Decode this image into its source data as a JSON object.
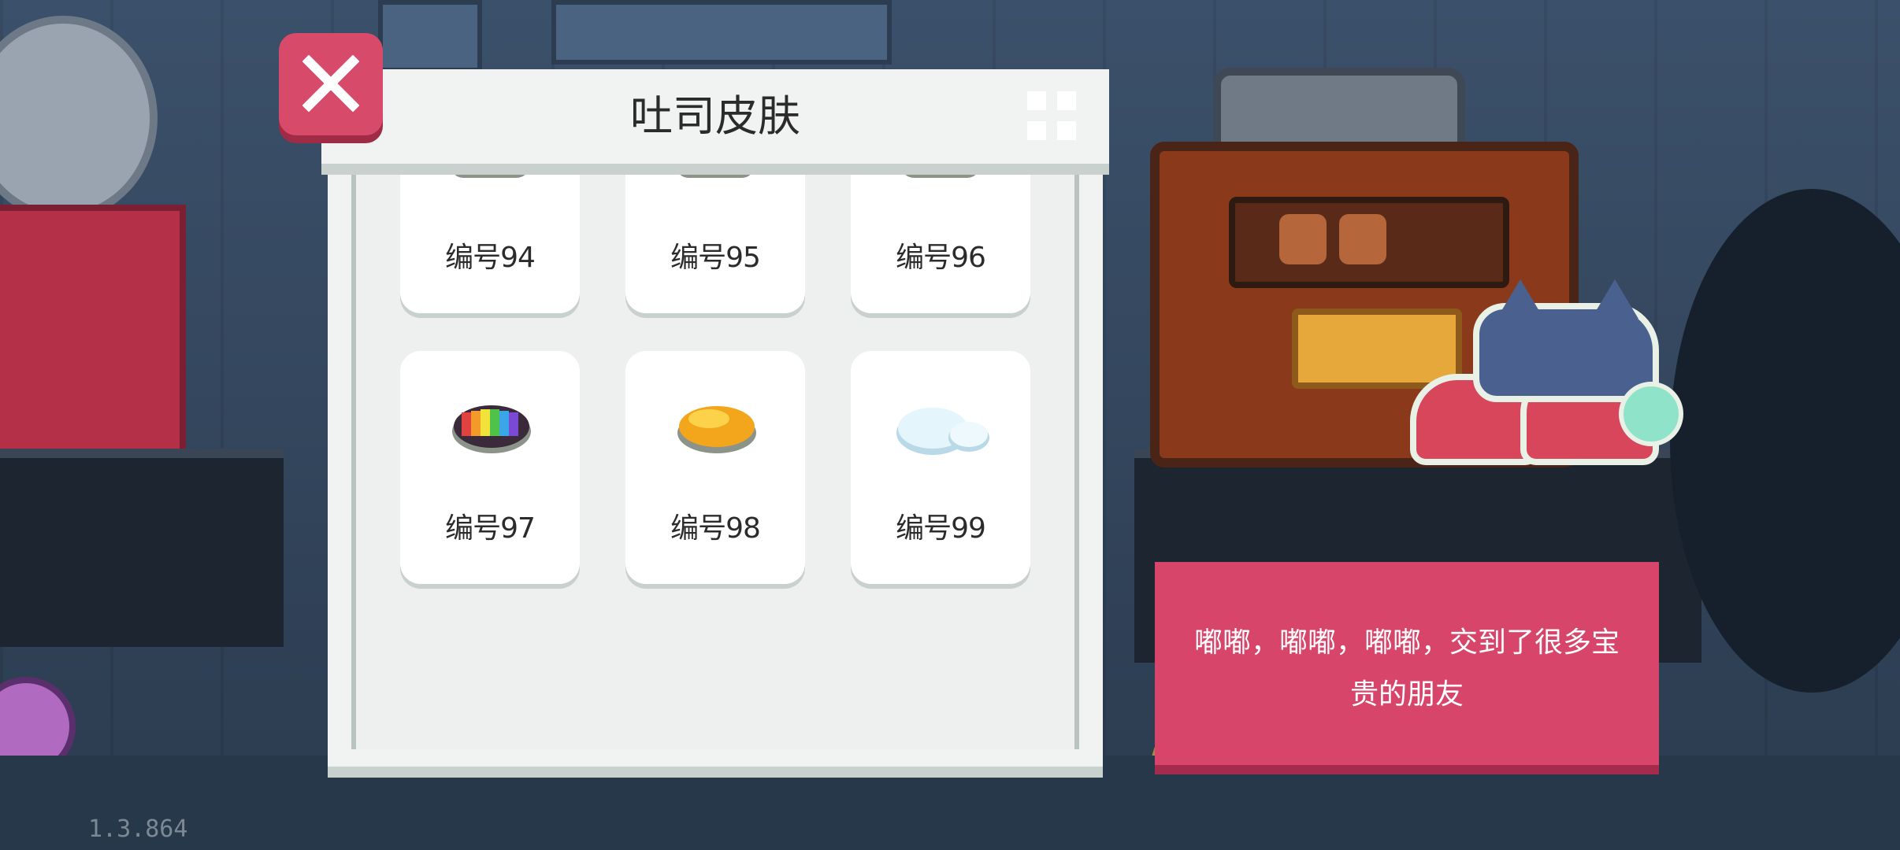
{
  "panel": {
    "title": "吐司皮肤",
    "items": [
      {
        "label": "编号94",
        "skin": "partial"
      },
      {
        "label": "编号95",
        "skin": "partial"
      },
      {
        "label": "编号96",
        "skin": "partial"
      },
      {
        "label": "编号97",
        "skin": "rainbow-toast-icon"
      },
      {
        "label": "编号98",
        "skin": "gold-toast-icon"
      },
      {
        "label": "编号99",
        "skin": "ice-toast-icon"
      }
    ]
  },
  "dialog": {
    "text": "嘟嘟，嘟嘟，嘟嘟，交到了很多宝贵的朋友"
  },
  "version": "1.3.864",
  "colors": {
    "accent": "#d8456a",
    "panel": "#f1f3f2",
    "card": "#ffffff"
  }
}
